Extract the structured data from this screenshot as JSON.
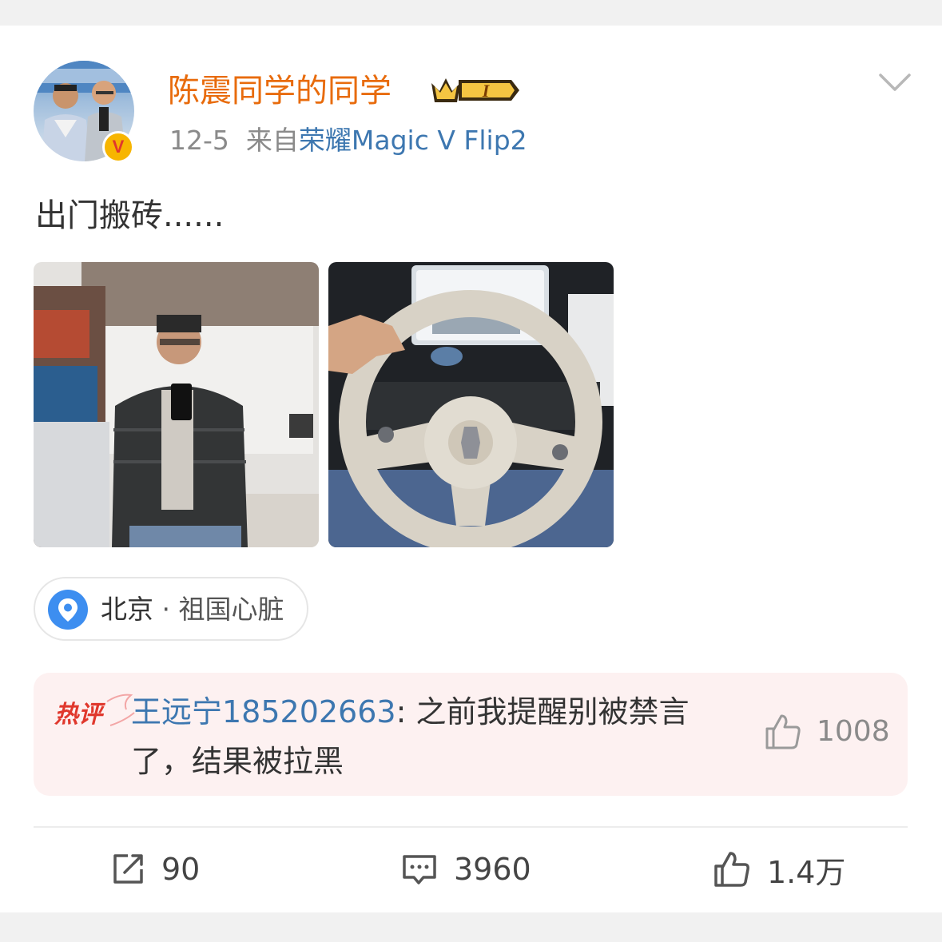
{
  "post": {
    "username": "陈震同学的同学",
    "member_badge_label": "I",
    "date": "12-5",
    "from_prefix": "来自",
    "source": "荣耀Magic V Flip2",
    "text": "出门搬砖......",
    "images": [
      "image-1-mirror-selfie",
      "image-2-steering-wheel"
    ],
    "location": {
      "city": "北京",
      "sep": " · ",
      "name": "祖国心脏"
    },
    "verified_badge": "V",
    "menu_icon": "chevron-down-icon"
  },
  "hot_comment": {
    "tag": "热评",
    "author": "王远宁185202663",
    "colon": ": ",
    "text": "之前我提醒别被禁言了，结果被拉黑",
    "likes": "1008"
  },
  "actions": {
    "repost": "90",
    "comments": "3960",
    "likes": "1.4万"
  },
  "colors": {
    "username": "#e86b0c",
    "link": "#3d77b0",
    "hot_bg": "#fdf1f1",
    "hot_tag": "#e0382d"
  }
}
